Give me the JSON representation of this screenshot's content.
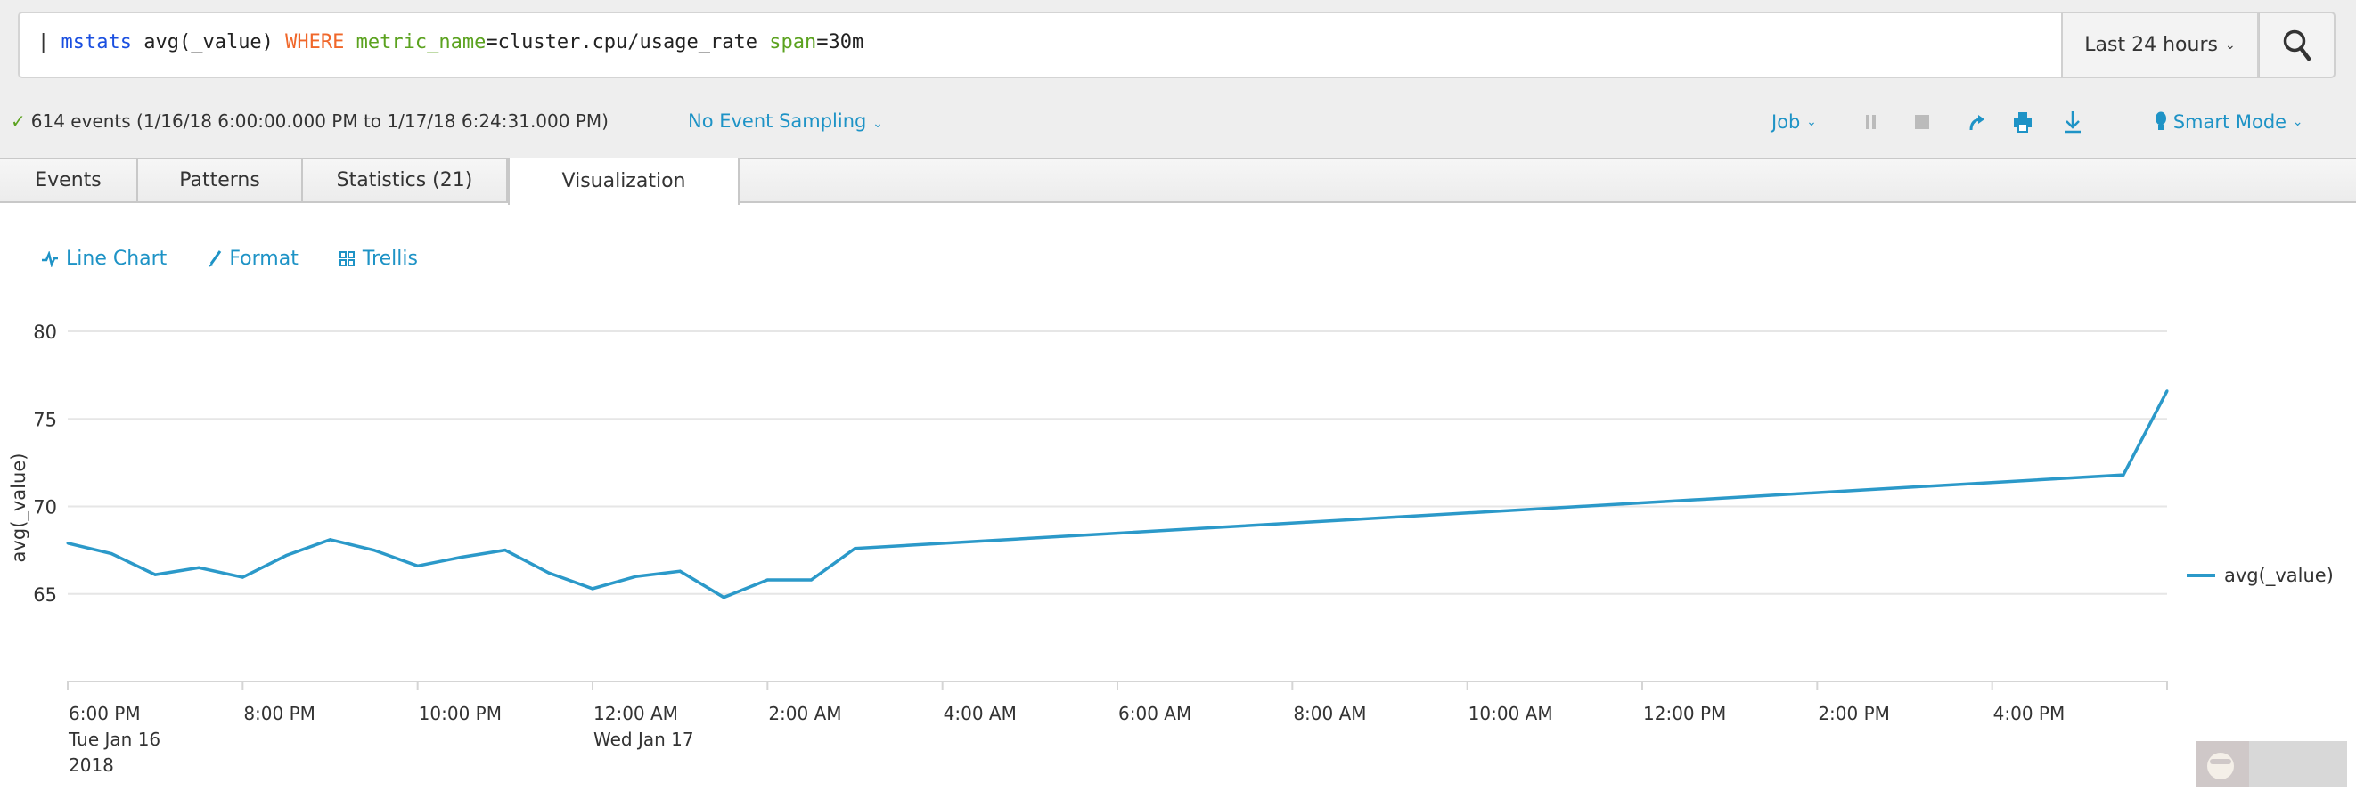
{
  "search": {
    "query_parts": [
      {
        "text": "| ",
        "role": "pipe"
      },
      {
        "text": "mstats",
        "role": "command"
      },
      {
        "text": " avg(_value) ",
        "role": "text"
      },
      {
        "text": "WHERE",
        "role": "keyword"
      },
      {
        "text": " ",
        "role": "text"
      },
      {
        "text": "metric_name",
        "role": "argument"
      },
      {
        "text": "=cluster.cpu/usage_rate ",
        "role": "text"
      },
      {
        "text": "span",
        "role": "argument"
      },
      {
        "text": "=30m",
        "role": "text"
      }
    ],
    "time_range": "Last 24 hours",
    "search_icon": "magnifier-icon"
  },
  "status": {
    "summary": "614 events (1/16/18 6:00:00.000 PM to 1/17/18 6:24:31.000 PM)",
    "sampling": "No Event Sampling",
    "job": "Job",
    "mode": "Smart Mode"
  },
  "tabs": [
    {
      "label": "Events"
    },
    {
      "label": "Patterns"
    },
    {
      "label": "Statistics (21)"
    },
    {
      "label": "Visualization",
      "active": true
    }
  ],
  "chart_toolbar": {
    "line_chart": "Line Chart",
    "format": "Format",
    "trellis": "Trellis"
  },
  "colors": {
    "accent": "#1e93c6",
    "series": "#2b99c9"
  },
  "chart_data": {
    "type": "line",
    "title": "",
    "xlabel": "",
    "ylabel": "avg(_value)",
    "ylim": [
      60,
      80
    ],
    "yticks": [
      65,
      70,
      75,
      80
    ],
    "x_range_hours": [
      0,
      24
    ],
    "xticks": [
      {
        "h": 0,
        "lines": [
          "6:00 PM",
          "Tue Jan 16",
          "2018"
        ]
      },
      {
        "h": 2,
        "lines": [
          "8:00 PM"
        ]
      },
      {
        "h": 4,
        "lines": [
          "10:00 PM"
        ]
      },
      {
        "h": 6,
        "lines": [
          "12:00 AM",
          "Wed Jan 17"
        ]
      },
      {
        "h": 8,
        "lines": [
          "2:00 AM"
        ]
      },
      {
        "h": 10,
        "lines": [
          "4:00 AM"
        ]
      },
      {
        "h": 12,
        "lines": [
          "6:00 AM"
        ]
      },
      {
        "h": 14,
        "lines": [
          "8:00 AM"
        ]
      },
      {
        "h": 16,
        "lines": [
          "10:00 AM"
        ]
      },
      {
        "h": 18,
        "lines": [
          "12:00 PM"
        ]
      },
      {
        "h": 20,
        "lines": [
          "2:00 PM"
        ]
      },
      {
        "h": 22,
        "lines": [
          "4:00 PM"
        ]
      }
    ],
    "legend": {
      "position": "right",
      "entries": [
        "avg(_value)"
      ]
    },
    "series": [
      {
        "name": "avg(_value)",
        "x_hours_from_6pm": [
          0,
          0.5,
          1,
          1.5,
          2,
          2.5,
          3,
          3.5,
          4,
          4.5,
          5,
          5.5,
          6,
          6.5,
          7,
          7.5,
          8,
          8.5,
          9,
          23.5,
          24
        ],
        "values": [
          67.9,
          67.3,
          66.1,
          66.5,
          65.95,
          67.2,
          68.1,
          67.5,
          66.6,
          67.1,
          67.5,
          66.2,
          65.3,
          66.0,
          66.3,
          64.8,
          65.8,
          65.8,
          67.6,
          71.8,
          76.6
        ]
      }
    ]
  }
}
